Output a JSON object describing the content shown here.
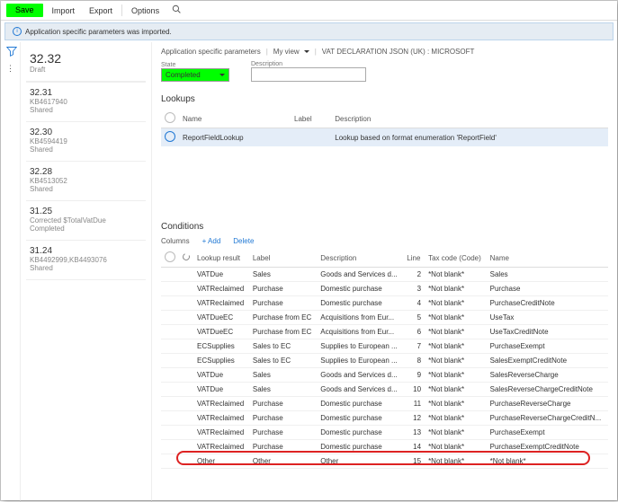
{
  "toolbar": {
    "save": "Save",
    "import": "Import",
    "export": "Export",
    "options": "Options"
  },
  "infobar": {
    "message": "Application specific parameters was imported."
  },
  "versions": [
    {
      "ver": "32.32",
      "sub1": "Draft",
      "sub2": ""
    },
    {
      "ver": "32.31",
      "sub1": "KB4617940",
      "sub2": "Shared"
    },
    {
      "ver": "32.30",
      "sub1": "KB4594419",
      "sub2": "Shared"
    },
    {
      "ver": "32.28",
      "sub1": "KB4513052",
      "sub2": "Shared"
    },
    {
      "ver": "31.25",
      "sub1": "Corrected $TotalVatDue",
      "sub2": "Completed"
    },
    {
      "ver": "31.24",
      "sub1": "KB4492999,KB4493076",
      "sub2": "Shared"
    }
  ],
  "crumb": {
    "a": "Application specific parameters",
    "b": "My view",
    "c": "VAT DECLARATION JSON (UK) : MICROSOFT"
  },
  "state": {
    "label": "State",
    "value": "Completed"
  },
  "desc": {
    "label": "Description",
    "value": ""
  },
  "lookups": {
    "title": "Lookups",
    "cols": {
      "name": "Name",
      "label": "Label",
      "desc": "Description"
    },
    "row": {
      "name": "ReportFieldLookup",
      "label": "",
      "desc": "Lookup based on format enumeration 'ReportField'"
    }
  },
  "conditions": {
    "title": "Conditions",
    "bar": {
      "columns": "Columns",
      "add": "+ Add",
      "del": "Delete"
    },
    "cols": {
      "res": "Lookup result",
      "label": "Label",
      "desc": "Description",
      "line": "Line",
      "tax": "Tax code (Code)",
      "name": "Name"
    },
    "rows": [
      {
        "res": "VATDue",
        "label": "Sales",
        "desc": "Goods and Services d...",
        "line": "2",
        "tax": "*Not blank*",
        "name": "Sales"
      },
      {
        "res": "VATReclaimed",
        "label": "Purchase",
        "desc": "Domestic purchase",
        "line": "3",
        "tax": "*Not blank*",
        "name": "Purchase"
      },
      {
        "res": "VATReclaimed",
        "label": "Purchase",
        "desc": "Domestic purchase",
        "line": "4",
        "tax": "*Not blank*",
        "name": "PurchaseCreditNote"
      },
      {
        "res": "VATDueEC",
        "label": "Purchase from EC",
        "desc": "Acquisitions from Eur...",
        "line": "5",
        "tax": "*Not blank*",
        "name": "UseTax"
      },
      {
        "res": "VATDueEC",
        "label": "Purchase from EC",
        "desc": "Acquisitions from Eur...",
        "line": "6",
        "tax": "*Not blank*",
        "name": "UseTaxCreditNote"
      },
      {
        "res": "ECSupplies",
        "label": "Sales to EC",
        "desc": "Supplies to European ...",
        "line": "7",
        "tax": "*Not blank*",
        "name": "PurchaseExempt"
      },
      {
        "res": "ECSupplies",
        "label": "Sales to EC",
        "desc": "Supplies to European ...",
        "line": "8",
        "tax": "*Not blank*",
        "name": "SalesExemptCreditNote"
      },
      {
        "res": "VATDue",
        "label": "Sales",
        "desc": "Goods and Services d...",
        "line": "9",
        "tax": "*Not blank*",
        "name": "SalesReverseCharge"
      },
      {
        "res": "VATDue",
        "label": "Sales",
        "desc": "Goods and Services d...",
        "line": "10",
        "tax": "*Not blank*",
        "name": "SalesReverseChargeCreditNote"
      },
      {
        "res": "VATReclaimed",
        "label": "Purchase",
        "desc": "Domestic purchase",
        "line": "11",
        "tax": "*Not blank*",
        "name": "PurchaseReverseCharge"
      },
      {
        "res": "VATReclaimed",
        "label": "Purchase",
        "desc": "Domestic purchase",
        "line": "12",
        "tax": "*Not blank*",
        "name": "PurchaseReverseChargeCreditN..."
      },
      {
        "res": "VATReclaimed",
        "label": "Purchase",
        "desc": "Domestic purchase",
        "line": "13",
        "tax": "*Not blank*",
        "name": "PurchaseExempt"
      },
      {
        "res": "VATReclaimed",
        "label": "Purchase",
        "desc": "Domestic purchase",
        "line": "14",
        "tax": "*Not blank*",
        "name": "PurchaseExemptCreditNote"
      },
      {
        "res": "Other",
        "label": "Other",
        "desc": "Other",
        "line": "15",
        "tax": "*Not blank*",
        "name": "*Not blank*"
      }
    ]
  }
}
